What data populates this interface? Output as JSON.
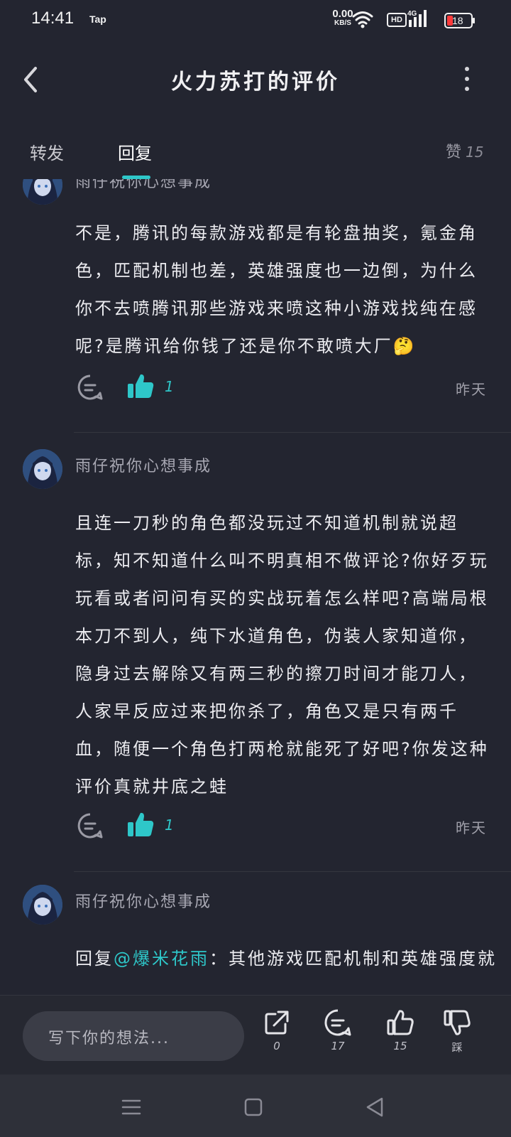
{
  "status_bar": {
    "time": "14:41",
    "app_label": "Tap",
    "net_speed_value": "0.00",
    "net_speed_unit": "KB/S",
    "hd_label": "HD",
    "signal_label": "4G",
    "battery": "18",
    "battery_color": "#ff3b3b"
  },
  "header": {
    "title": "火力苏打的评价"
  },
  "tabs": {
    "forward": "转发",
    "reply": "回复",
    "likes_label": "赞",
    "likes_count": "15",
    "accent": "#2ec7c9"
  },
  "comments": [
    {
      "username": "雨仔祝你心想事成",
      "text": "不是，腾讯的每款游戏都是有轮盘抽奖，氪金角色，匹配机制也差，英雄强度也一边倒，为什么你不去喷腾讯那些游戏来喷这种小游戏找纯在感呢?是腾讯给你钱了还是你不敢喷大厂🤔",
      "likes": "1",
      "time": "昨天"
    },
    {
      "username": "雨仔祝你心想事成",
      "text": "且连一刀秒的角色都没玩过不知道机制就说超标，知不知道什么叫不明真相不做评论?你好歹玩玩看或者问问有买的实战玩着怎么样吧?高端局根本刀不到人，纯下水道角色，伪装人家知道你，隐身过去解除又有两三秒的擦刀时间才能刀人，人家早反应过来把你杀了，角色又是只有两千血，随便一个角色打两枪就能死了好吧?你发这种评价真就井底之蛙",
      "likes": "1",
      "time": "昨天"
    },
    {
      "username": "雨仔祝你心想事成",
      "reply_prefix": "回复",
      "mention": "@爆米花雨",
      "text": "：其他游戏匹配机制和英雄强度就"
    }
  ],
  "bottom_bar": {
    "input_placeholder": "写下你的想法...",
    "share_count": "0",
    "comment_count": "17",
    "like_count": "15",
    "dislike_label": "踩"
  },
  "nav": {
    "menu_icon": "menu-icon",
    "home_icon": "home-icon",
    "back_icon": "back-triangle-icon"
  }
}
